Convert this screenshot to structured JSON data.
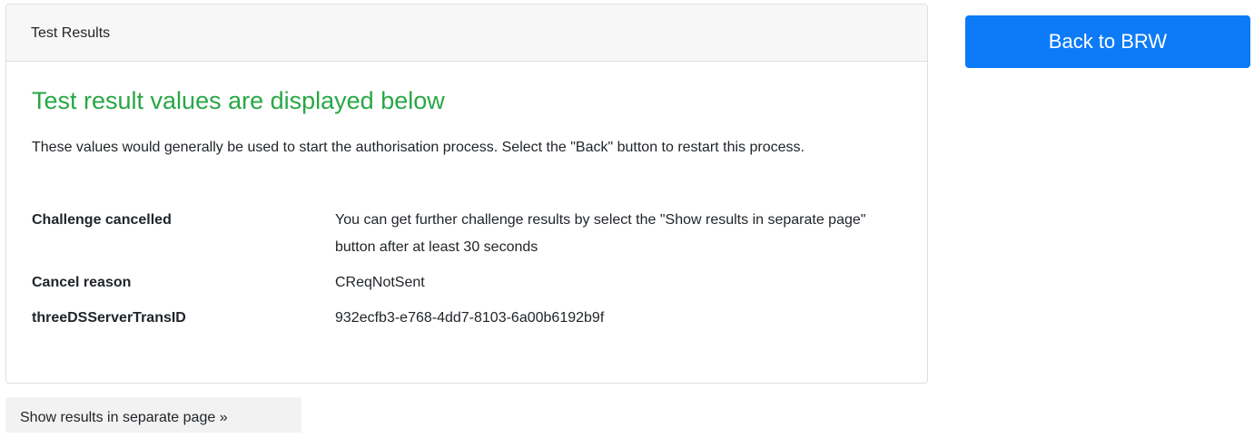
{
  "card": {
    "header": "Test Results",
    "heading": "Test result values are displayed below",
    "description": "These values would generally be used to start the authorisation process. Select the \"Back\" button to restart this process.",
    "rows": [
      {
        "key": "Challenge cancelled",
        "value": "You can get further challenge results by select the \"Show results in separate page\" button after at least 30 seconds"
      },
      {
        "key": "Cancel reason",
        "value": "CReqNotSent"
      },
      {
        "key": "threeDSServerTransID",
        "value": "932ecfb3-e768-4dd7-8103-6a00b6192b9f"
      }
    ]
  },
  "buttons": {
    "back_label": "Back to BRW",
    "show_results_label": "Show results in separate page »"
  },
  "colors": {
    "heading_green": "#28a745",
    "primary_blue": "#0d7bf7",
    "header_bg": "#f7f7f7"
  }
}
